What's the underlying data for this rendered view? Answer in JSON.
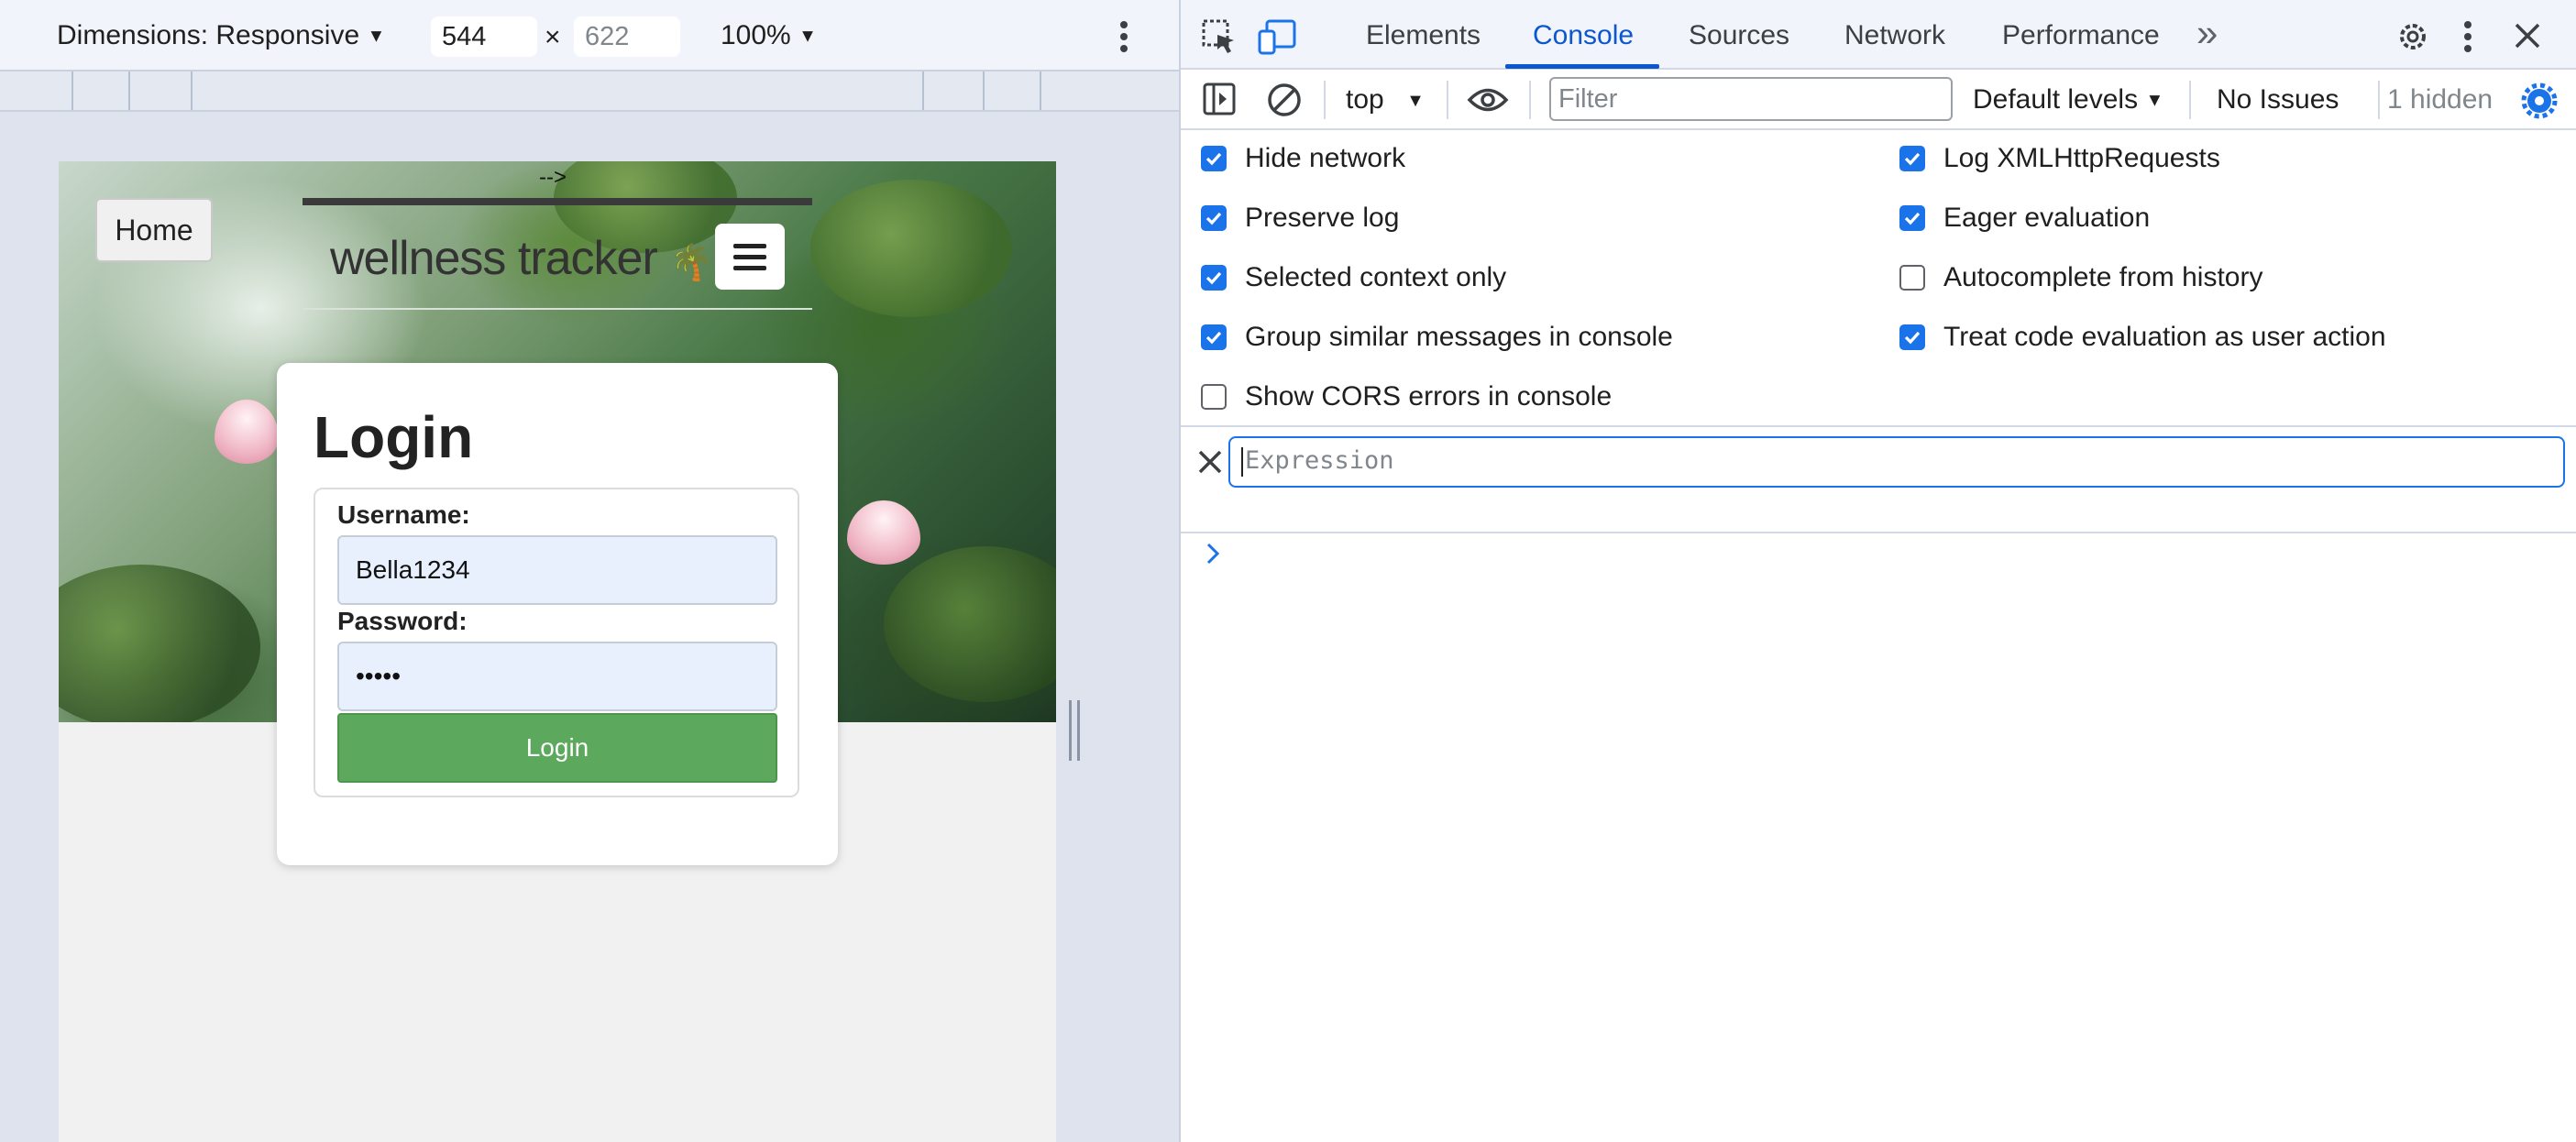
{
  "device_toolbar": {
    "dimensions_label": "Dimensions: Responsive",
    "width": "544",
    "times": "×",
    "height": "622",
    "zoom": "100%"
  },
  "page": {
    "comment_arrow": "-->",
    "home_label": "Home",
    "brand": "wellness tracker",
    "brand_emoji": "🌴",
    "login": {
      "title": "Login",
      "username_label": "Username:",
      "username_value": "Bella1234",
      "password_label": "Password:",
      "password_value": "•••••",
      "button_label": "Login"
    }
  },
  "devtools": {
    "tabs": [
      "Elements",
      "Console",
      "Sources",
      "Network",
      "Performance"
    ],
    "active_tab": "Console",
    "more_tabs": "»",
    "toolbar": {
      "context": "top",
      "filter_placeholder": "Filter",
      "levels": "Default levels",
      "issues": "No Issues",
      "hidden": "1 hidden"
    },
    "settings": [
      {
        "label": "Hide network",
        "checked": true
      },
      {
        "label": "Log XMLHttpRequests",
        "checked": true
      },
      {
        "label": "Preserve log",
        "checked": true
      },
      {
        "label": "Eager evaluation",
        "checked": true
      },
      {
        "label": "Selected context only",
        "checked": true
      },
      {
        "label": "Autocomplete from history",
        "checked": false
      },
      {
        "label": "Group similar messages in console",
        "checked": true
      },
      {
        "label": "Treat code evaluation as user action",
        "checked": true
      },
      {
        "label": "Show CORS errors in console",
        "checked": false
      }
    ],
    "expression_placeholder": "Expression",
    "colors": {
      "accent": "#0b57d0",
      "checkbox": "#1a73e8",
      "login_button": "#5ca85c"
    }
  }
}
